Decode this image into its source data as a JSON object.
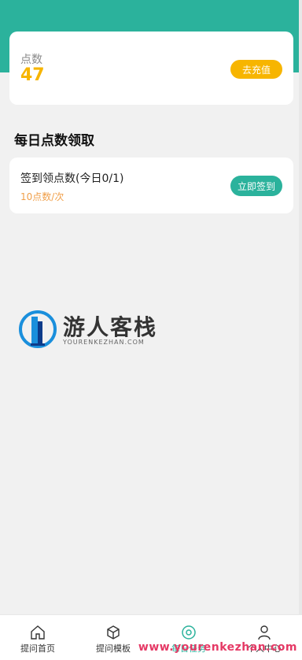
{
  "points": {
    "label": "点数",
    "value": "47",
    "recharge_button": "去充值"
  },
  "section_title": "每日点数领取",
  "task": {
    "title": "签到领点数(今日0/1)",
    "reward": "10点数/次",
    "checkin_button": "立即签到"
  },
  "watermark": {
    "cn": "游人客栈",
    "en": "YOURENKEZHAN.COM",
    "url": "www.yourenkezhan.com"
  },
  "tabs": [
    {
      "label": "提问首页",
      "icon": "home-icon"
    },
    {
      "label": "提问模板",
      "icon": "cube-icon"
    },
    {
      "label": "每日任务",
      "icon": "target-icon"
    },
    {
      "label": "个人中心",
      "icon": "user-icon"
    }
  ],
  "colors": {
    "primary": "#2bb29c",
    "accent": "#f7b500",
    "reward": "#f0a04b"
  }
}
